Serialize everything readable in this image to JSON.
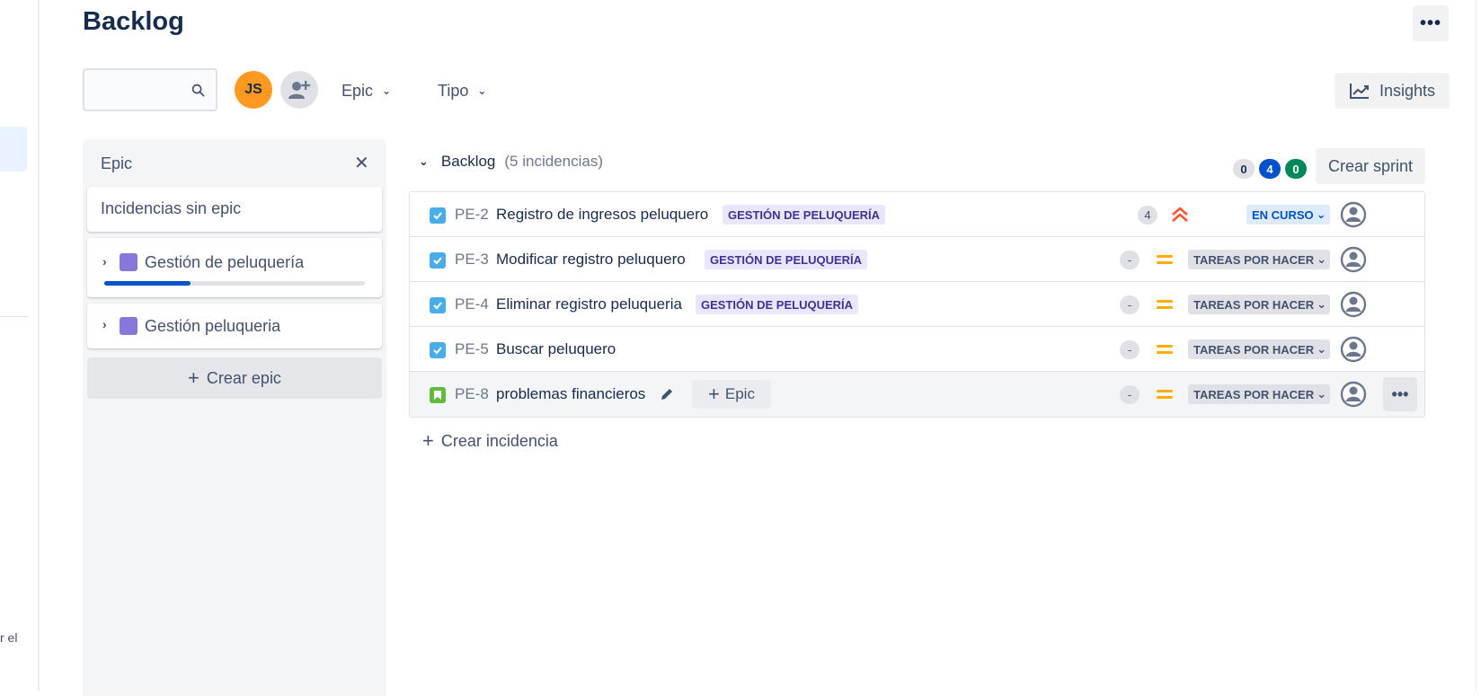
{
  "left_strip": {
    "fragment_text": "r el"
  },
  "page": {
    "title": "Backlog",
    "more_label": "•••"
  },
  "toolbar": {
    "search": {
      "value": "",
      "placeholder": ""
    },
    "avatar_initials": "JS",
    "filters": [
      {
        "label": "Epic"
      },
      {
        "label": "Tipo"
      }
    ],
    "insights_label": "Insights"
  },
  "epic_panel": {
    "title": "Epic",
    "close_label": "✕",
    "no_epic_label": "Incidencias sin epic",
    "epics": [
      {
        "label": "Gestión de peluquería",
        "color": "#8777d9",
        "progress": 0.33
      },
      {
        "label": "Gestión peluqueria",
        "color": "#8777d9"
      }
    ],
    "create_epic_label": "Crear epic"
  },
  "backlog": {
    "title": "Backlog",
    "count_label": "(5 incidencias)",
    "status_counts": {
      "todo": "0",
      "in_progress": "4",
      "done": "0"
    },
    "create_sprint_label": "Crear sprint",
    "issues": [
      {
        "key": "PE-2",
        "type": "task",
        "title": "Registro de ingresos peluquero",
        "epic": "GESTIÓN DE PELUQUERÍA",
        "estimate": "4",
        "priority": "highest",
        "status": "EN CURSO"
      },
      {
        "key": "PE-3",
        "type": "task",
        "title": "Modificar registro peluquero",
        "epic": "GESTIÓN DE PELUQUERÍA",
        "estimate": "-",
        "priority": "medium",
        "status": "TAREAS POR HACER"
      },
      {
        "key": "PE-4",
        "type": "task",
        "title": "Eliminar registro peluqueria",
        "epic": "GESTIÓN DE PELUQUERÍA",
        "estimate": "-",
        "priority": "medium",
        "status": "TAREAS POR HACER"
      },
      {
        "key": "PE-5",
        "type": "task",
        "title": "Buscar peluquero",
        "epic": "",
        "estimate": "-",
        "priority": "medium",
        "status": "TAREAS POR HACER"
      },
      {
        "key": "PE-8",
        "type": "story",
        "title": "problemas financieros",
        "epic": "",
        "add_epic_label": "Epic",
        "estimate": "-",
        "priority": "medium",
        "status": "TAREAS POR HACER",
        "more_label": "•••"
      }
    ],
    "create_issue_label": "Crear incidencia"
  },
  "colors": {
    "brand": "#0052cc",
    "epic_lozenge_bg": "#eae6ff",
    "epic_lozenge_text": "#403294",
    "priority_medium": "#ffab00",
    "priority_highest": "#ff5630"
  }
}
